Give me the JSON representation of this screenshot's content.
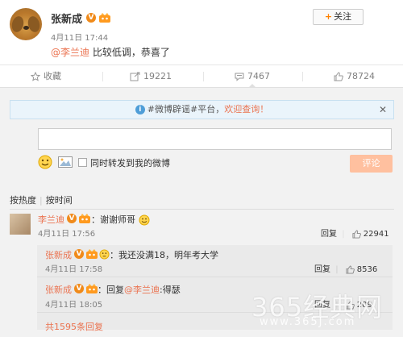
{
  "post": {
    "username": "张新成",
    "v_badge": "V",
    "follow_plus": "+",
    "follow_label": "关注",
    "time": "4月11日 17:44",
    "mention": "@李兰迪",
    "text": " 比较低调，恭喜了"
  },
  "actions": {
    "favorite_label": "收藏",
    "forward_count": "19221",
    "comment_count": "7467",
    "like_count": "78724"
  },
  "comment_box": {
    "notice_info_icon": "i",
    "notice_hashtag": "#微博辟谣#平台，",
    "notice_welcome": "欢迎查询！",
    "notice_close": "✕",
    "input_value": "",
    "forward_option": "同时转发到我的微博",
    "submit_label": "评论"
  },
  "sort": {
    "hot": "按热度",
    "separator": "|",
    "time": "按时间"
  },
  "comments": [
    {
      "name": "李兰迪",
      "v_badge": "V",
      "text": "：谢谢师哥",
      "time": "4月11日 17:56",
      "reply_label": "回复",
      "likes": "22941"
    }
  ],
  "replies": [
    {
      "name": "张新成",
      "v_badge": "V",
      "text": "：我还没满18，明年考大学",
      "time": "4月11日 17:58",
      "reply_label": "回复",
      "likes": "8536"
    },
    {
      "name": "张新成",
      "v_badge": "V",
      "text_prefix": "：回复",
      "mention": "@李兰迪",
      "text_suffix": ":得瑟",
      "time": "4月11日 18:05",
      "reply_label": "回复",
      "likes": "209"
    }
  ],
  "total_replies": "共1595条回复",
  "watermark": {
    "big": "365经典网",
    "small": "www.365J.com"
  },
  "colors": {
    "accent": "#eb7350",
    "follow_plus": "#ff8200",
    "v_badge": "#f08a1a",
    "submit_bg": "#ffc09f"
  }
}
